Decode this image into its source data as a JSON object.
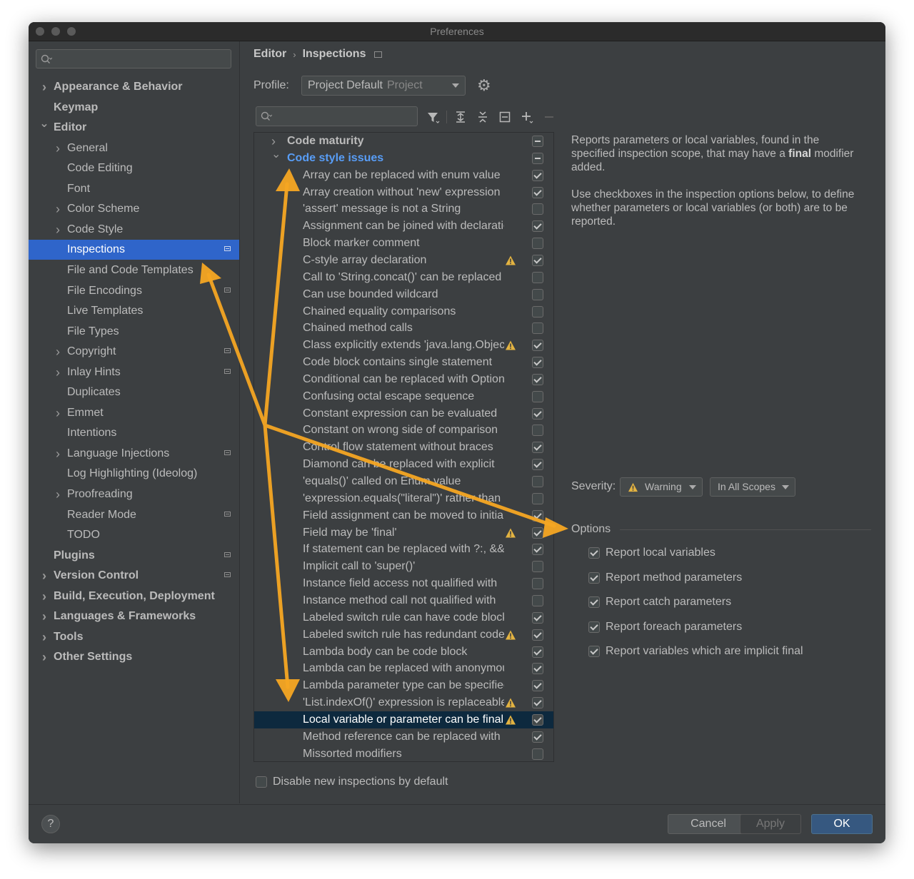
{
  "window": {
    "title": "Preferences"
  },
  "sidebar": {
    "items": [
      {
        "label": "Appearance & Behavior",
        "level": 0,
        "chevron": "right",
        "bold": true,
        "project": false,
        "selected": false
      },
      {
        "label": "Keymap",
        "level": 0,
        "chevron": "none",
        "bold": true,
        "project": false,
        "selected": false
      },
      {
        "label": "Editor",
        "level": 0,
        "chevron": "down",
        "bold": true,
        "project": false,
        "selected": false
      },
      {
        "label": "General",
        "level": 1,
        "chevron": "right",
        "bold": false,
        "project": false,
        "selected": false
      },
      {
        "label": "Code Editing",
        "level": 1,
        "chevron": "none",
        "bold": false,
        "project": false,
        "selected": false
      },
      {
        "label": "Font",
        "level": 1,
        "chevron": "none",
        "bold": false,
        "project": false,
        "selected": false
      },
      {
        "label": "Color Scheme",
        "level": 1,
        "chevron": "right",
        "bold": false,
        "project": false,
        "selected": false
      },
      {
        "label": "Code Style",
        "level": 1,
        "chevron": "right",
        "bold": false,
        "project": false,
        "selected": false
      },
      {
        "label": "Inspections",
        "level": 1,
        "chevron": "none",
        "bold": false,
        "project": true,
        "selected": true
      },
      {
        "label": "File and Code Templates",
        "level": 1,
        "chevron": "none",
        "bold": false,
        "project": false,
        "selected": false
      },
      {
        "label": "File Encodings",
        "level": 1,
        "chevron": "none",
        "bold": false,
        "project": true,
        "selected": false
      },
      {
        "label": "Live Templates",
        "level": 1,
        "chevron": "none",
        "bold": false,
        "project": false,
        "selected": false
      },
      {
        "label": "File Types",
        "level": 1,
        "chevron": "none",
        "bold": false,
        "project": false,
        "selected": false
      },
      {
        "label": "Copyright",
        "level": 1,
        "chevron": "right",
        "bold": false,
        "project": true,
        "selected": false
      },
      {
        "label": "Inlay Hints",
        "level": 1,
        "chevron": "right",
        "bold": false,
        "project": true,
        "selected": false
      },
      {
        "label": "Duplicates",
        "level": 1,
        "chevron": "none",
        "bold": false,
        "project": false,
        "selected": false
      },
      {
        "label": "Emmet",
        "level": 1,
        "chevron": "right",
        "bold": false,
        "project": false,
        "selected": false
      },
      {
        "label": "Intentions",
        "level": 1,
        "chevron": "none",
        "bold": false,
        "project": false,
        "selected": false
      },
      {
        "label": "Language Injections",
        "level": 1,
        "chevron": "right",
        "bold": false,
        "project": true,
        "selected": false
      },
      {
        "label": "Log Highlighting (Ideolog)",
        "level": 1,
        "chevron": "none",
        "bold": false,
        "project": false,
        "selected": false
      },
      {
        "label": "Proofreading",
        "level": 1,
        "chevron": "right",
        "bold": false,
        "project": false,
        "selected": false
      },
      {
        "label": "Reader Mode",
        "level": 1,
        "chevron": "none",
        "bold": false,
        "project": true,
        "selected": false
      },
      {
        "label": "TODO",
        "level": 1,
        "chevron": "none",
        "bold": false,
        "project": false,
        "selected": false
      },
      {
        "label": "Plugins",
        "level": 0,
        "chevron": "none",
        "bold": true,
        "project": true,
        "selected": false
      },
      {
        "label": "Version Control",
        "level": 0,
        "chevron": "right",
        "bold": true,
        "project": true,
        "selected": false
      },
      {
        "label": "Build, Execution, Deployment",
        "level": 0,
        "chevron": "right",
        "bold": true,
        "project": false,
        "selected": false
      },
      {
        "label": "Languages & Frameworks",
        "level": 0,
        "chevron": "right",
        "bold": true,
        "project": false,
        "selected": false
      },
      {
        "label": "Tools",
        "level": 0,
        "chevron": "right",
        "bold": true,
        "project": false,
        "selected": false
      },
      {
        "label": "Other Settings",
        "level": 0,
        "chevron": "right",
        "bold": true,
        "project": false,
        "selected": false
      }
    ]
  },
  "breadcrumb": {
    "part1": "Editor",
    "separator": "›",
    "part2": "Inspections"
  },
  "profile": {
    "label": "Profile:",
    "value": "Project Default",
    "scope": "Project"
  },
  "toolbar": {
    "icons": [
      "filter-icon",
      "expand-all-icon",
      "collapse-all-icon",
      "reset-icon",
      "add-icon",
      "remove-icon"
    ]
  },
  "inspections": {
    "rows": [
      {
        "label": "Code maturity",
        "type": "group",
        "chevron": "right",
        "state": "mixed",
        "warning": false,
        "selected": false,
        "blue": false
      },
      {
        "label": "Code style issues",
        "type": "group",
        "chevron": "down",
        "state": "mixed",
        "warning": false,
        "selected": false,
        "blue": true
      },
      {
        "label": "Array can be replaced with enum value",
        "type": "item",
        "state": "on",
        "warning": false,
        "selected": false
      },
      {
        "label": "Array creation without 'new' expression",
        "type": "item",
        "state": "on",
        "warning": false,
        "selected": false
      },
      {
        "label": "'assert' message is not a String",
        "type": "item",
        "state": "off",
        "warning": false,
        "selected": false
      },
      {
        "label": "Assignment can be joined with declaration",
        "type": "item",
        "state": "on",
        "warning": false,
        "selected": false
      },
      {
        "label": "Block marker comment",
        "type": "item",
        "state": "off",
        "warning": false,
        "selected": false
      },
      {
        "label": "C-style array declaration",
        "type": "item",
        "state": "on",
        "warning": true,
        "selected": false
      },
      {
        "label": "Call to 'String.concat()' can be replaced",
        "type": "item",
        "state": "off",
        "warning": false,
        "selected": false
      },
      {
        "label": "Can use bounded wildcard",
        "type": "item",
        "state": "off",
        "warning": false,
        "selected": false
      },
      {
        "label": "Chained equality comparisons",
        "type": "item",
        "state": "off",
        "warning": false,
        "selected": false
      },
      {
        "label": "Chained method calls",
        "type": "item",
        "state": "off",
        "warning": false,
        "selected": false
      },
      {
        "label": "Class explicitly extends 'java.lang.Object'",
        "type": "item",
        "state": "on",
        "warning": true,
        "selected": false
      },
      {
        "label": "Code block contains single statement",
        "type": "item",
        "state": "on",
        "warning": false,
        "selected": false
      },
      {
        "label": "Conditional can be replaced with Optional",
        "type": "item",
        "state": "on",
        "warning": false,
        "selected": false
      },
      {
        "label": "Confusing octal escape sequence",
        "type": "item",
        "state": "off",
        "warning": false,
        "selected": false
      },
      {
        "label": "Constant expression can be evaluated",
        "type": "item",
        "state": "on",
        "warning": false,
        "selected": false
      },
      {
        "label": "Constant on wrong side of comparison",
        "type": "item",
        "state": "off",
        "warning": false,
        "selected": false
      },
      {
        "label": "Control flow statement without braces",
        "type": "item",
        "state": "on",
        "warning": false,
        "selected": false
      },
      {
        "label": "Diamond can be replaced with explicit",
        "type": "item",
        "state": "on",
        "warning": false,
        "selected": false
      },
      {
        "label": "'equals()' called on Enum value",
        "type": "item",
        "state": "off",
        "warning": false,
        "selected": false
      },
      {
        "label": "'expression.equals(\"literal\")' rather than",
        "type": "item",
        "state": "off",
        "warning": false,
        "selected": false
      },
      {
        "label": "Field assignment can be moved to initializer",
        "type": "item",
        "state": "on",
        "warning": false,
        "selected": false
      },
      {
        "label": "Field may be 'final'",
        "type": "item",
        "state": "on",
        "warning": true,
        "selected": false
      },
      {
        "label": "If statement can be replaced with ?:, &&",
        "type": "item",
        "state": "on",
        "warning": false,
        "selected": false
      },
      {
        "label": "Implicit call to 'super()'",
        "type": "item",
        "state": "off",
        "warning": false,
        "selected": false
      },
      {
        "label": "Instance field access not qualified with",
        "type": "item",
        "state": "off",
        "warning": false,
        "selected": false
      },
      {
        "label": "Instance method call not qualified with",
        "type": "item",
        "state": "off",
        "warning": false,
        "selected": false
      },
      {
        "label": "Labeled switch rule can have code block",
        "type": "item",
        "state": "on",
        "warning": false,
        "selected": false
      },
      {
        "label": "Labeled switch rule has redundant code",
        "type": "item",
        "state": "on",
        "warning": true,
        "selected": false
      },
      {
        "label": "Lambda body can be code block",
        "type": "item",
        "state": "on",
        "warning": false,
        "selected": false
      },
      {
        "label": "Lambda can be replaced with anonymous",
        "type": "item",
        "state": "on",
        "warning": false,
        "selected": false
      },
      {
        "label": "Lambda parameter type can be specified",
        "type": "item",
        "state": "on",
        "warning": false,
        "selected": false
      },
      {
        "label": "'List.indexOf()' expression is replaceable",
        "type": "item",
        "state": "on",
        "warning": true,
        "selected": false
      },
      {
        "label": "Local variable or parameter can be final",
        "type": "item",
        "state": "on",
        "warning": true,
        "selected": true
      },
      {
        "label": "Method reference can be replaced with",
        "type": "item",
        "state": "on",
        "warning": false,
        "selected": false
      },
      {
        "label": "Missorted modifiers",
        "type": "item",
        "state": "off",
        "warning": false,
        "selected": false
      }
    ]
  },
  "description": {
    "p1_before": "Reports parameters or local variables, found in the specified inspection scope, that may have a ",
    "p1_bold": "final",
    "p1_after": " modifier added.",
    "p2": "Use checkboxes in the inspection options below, to define whether parameters or local variables (or both) are to be reported."
  },
  "severity": {
    "label": "Severity:",
    "value": "Warning",
    "scope": "In All Scopes"
  },
  "options": {
    "title": "Options",
    "items": [
      {
        "label": "Report local variables",
        "checked": true
      },
      {
        "label": "Report method parameters",
        "checked": true
      },
      {
        "label": "Report catch parameters",
        "checked": true
      },
      {
        "label": "Report foreach parameters",
        "checked": true
      },
      {
        "label": "Report variables which are implicit final",
        "checked": true
      }
    ]
  },
  "disable_new": {
    "label": "Disable new inspections by default",
    "checked": false
  },
  "footer": {
    "help": "?",
    "cancel": "Cancel",
    "apply": "Apply",
    "ok": "OK"
  },
  "colors": {
    "accent": "#2f65ca",
    "selected_row": "#0d293e",
    "annotation": "#f5a623",
    "warning": "#e3b341",
    "link_blue": "#589df6"
  }
}
